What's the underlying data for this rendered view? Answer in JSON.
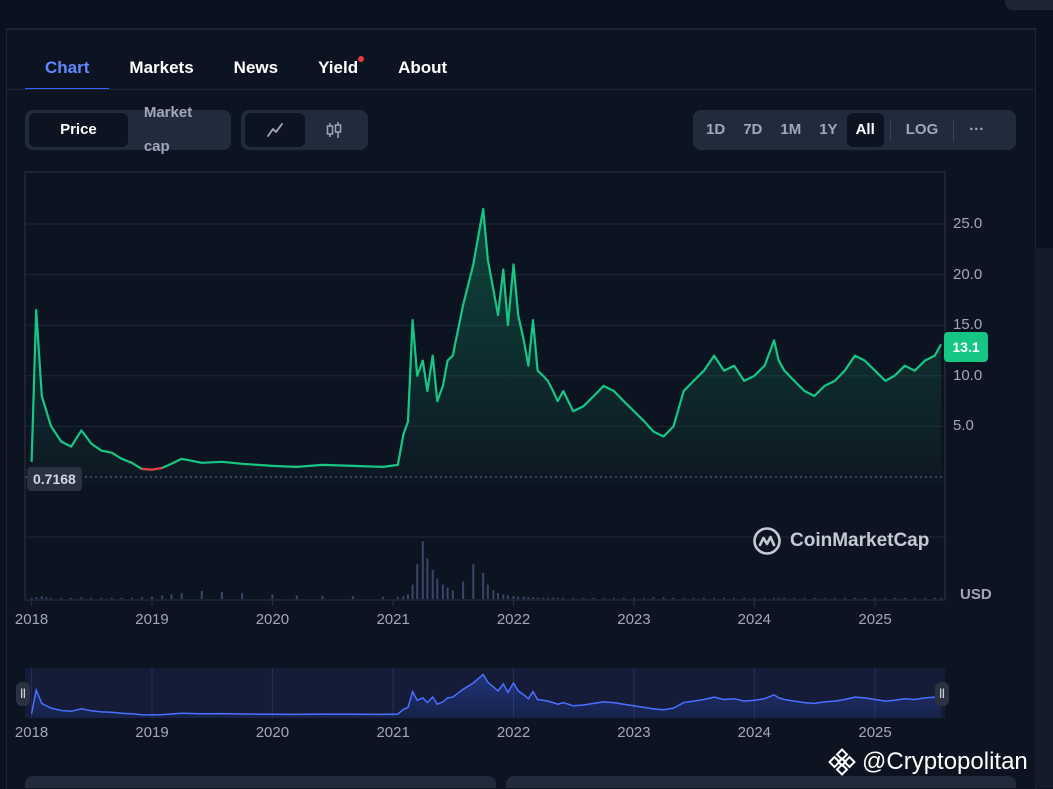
{
  "tabs": [
    {
      "label": "Chart",
      "active": true
    },
    {
      "label": "Markets",
      "active": false
    },
    {
      "label": "News",
      "active": false
    },
    {
      "label": "Yield",
      "active": false,
      "badge": true
    },
    {
      "label": "About",
      "active": false
    }
  ],
  "toolbar": {
    "price_label": "Price",
    "marketcap_label": "Market cap",
    "line_icon": "line-chart-icon",
    "candle_icon": "candlestick-icon",
    "ranges": [
      "1D",
      "7D",
      "1M",
      "1Y",
      "All"
    ],
    "selected_range": "All",
    "log_label": "LOG",
    "more_label": "···"
  },
  "chart_data": {
    "type": "area",
    "x": [
      "2018-01-01",
      "2018-01-15",
      "2018-02-01",
      "2018-02-15",
      "2018-03-01",
      "2018-04-01",
      "2018-05-01",
      "2018-06-01",
      "2018-07-01",
      "2018-08-01",
      "2018-09-01",
      "2018-10-01",
      "2018-11-01",
      "2018-12-01",
      "2019-01-01",
      "2019-02-01",
      "2019-03-01",
      "2019-04-01",
      "2019-06-01",
      "2019-08-01",
      "2019-10-01",
      "2020-01-01",
      "2020-03-15",
      "2020-06-01",
      "2020-09-01",
      "2020-12-01",
      "2021-01-15",
      "2021-02-01",
      "2021-02-15",
      "2021-03-01",
      "2021-03-15",
      "2021-04-01",
      "2021-04-15",
      "2021-05-01",
      "2021-05-15",
      "2021-06-01",
      "2021-06-15",
      "2021-07-01",
      "2021-08-01",
      "2021-09-01",
      "2021-10-01",
      "2021-10-15",
      "2021-11-01",
      "2021-11-15",
      "2021-12-01",
      "2021-12-15",
      "2022-01-01",
      "2022-01-15",
      "2022-02-01",
      "2022-02-15",
      "2022-03-01",
      "2022-03-15",
      "2022-04-01",
      "2022-04-15",
      "2022-05-01",
      "2022-05-15",
      "2022-06-01",
      "2022-07-01",
      "2022-08-01",
      "2022-09-01",
      "2022-10-01",
      "2022-11-01",
      "2022-12-01",
      "2023-01-01",
      "2023-02-01",
      "2023-03-01",
      "2023-04-01",
      "2023-05-01",
      "2023-06-01",
      "2023-07-01",
      "2023-08-01",
      "2023-09-01",
      "2023-10-01",
      "2023-11-01",
      "2023-12-01",
      "2024-01-01",
      "2024-02-01",
      "2024-03-01",
      "2024-03-15",
      "2024-04-01",
      "2024-05-01",
      "2024-06-01",
      "2024-07-01",
      "2024-08-01",
      "2024-09-01",
      "2024-10-01",
      "2024-11-01",
      "2024-12-01",
      "2025-01-01",
      "2025-02-01",
      "2025-03-01",
      "2025-04-01",
      "2025-05-01",
      "2025-06-01",
      "2025-07-01",
      "2025-07-20"
    ],
    "values": [
      1.5,
      16.5,
      8.0,
      6.5,
      5.0,
      3.5,
      3.0,
      4.6,
      3.3,
      2.6,
      2.4,
      1.8,
      1.4,
      0.8,
      0.72,
      0.9,
      1.3,
      1.8,
      1.4,
      1.5,
      1.3,
      1.1,
      1.0,
      1.2,
      1.1,
      1.0,
      1.2,
      4.2,
      5.5,
      15.5,
      10.0,
      11.5,
      8.5,
      12.0,
      7.5,
      9.0,
      11.5,
      12.0,
      17.0,
      21.0,
      26.5,
      21.5,
      18.5,
      16.0,
      20.5,
      15.0,
      21.0,
      16.0,
      13.5,
      11.0,
      15.5,
      10.5,
      10.0,
      9.5,
      8.5,
      7.5,
      8.5,
      6.5,
      7.0,
      8.0,
      9.0,
      8.5,
      7.5,
      6.5,
      5.5,
      4.5,
      4.0,
      5.0,
      8.5,
      9.5,
      10.5,
      12.0,
      10.5,
      11.0,
      9.5,
      10.0,
      11.0,
      13.5,
      11.5,
      10.5,
      9.5,
      8.5,
      8.0,
      9.0,
      9.5,
      10.5,
      12.0,
      11.5,
      10.5,
      9.5,
      10.0,
      11.0,
      10.5,
      11.5,
      12.0,
      13.1
    ],
    "y_ticks": [
      "25.0",
      "20.0",
      "15.0",
      "10.0",
      "5.0"
    ],
    "x_ticks": [
      "2018",
      "2019",
      "2020",
      "2021",
      "2022",
      "2023",
      "2024",
      "2025"
    ],
    "ylim": [
      0,
      28
    ],
    "current_price": "13.1",
    "low_marker": "0.7168",
    "currency": "USD",
    "line_color": "#16c784",
    "low_color": "#ea3943",
    "grid": true,
    "volume": [
      0.02,
      0.03,
      0.05,
      0.03,
      0.02,
      0.02,
      0.02,
      0.03,
      0.02,
      0.02,
      0.02,
      0.02,
      0.02,
      0.03,
      0.04,
      0.06,
      0.08,
      0.1,
      0.14,
      0.12,
      0.1,
      0.08,
      0.06,
      0.05,
      0.05,
      0.04,
      0.04,
      0.05,
      0.08,
      0.25,
      0.6,
      1.0,
      0.7,
      0.5,
      0.35,
      0.25,
      0.2,
      0.15,
      0.3,
      0.6,
      0.45,
      0.25,
      0.15,
      0.1,
      0.08,
      0.06,
      0.05,
      0.04,
      0.04,
      0.03,
      0.03,
      0.02,
      0.02,
      0.02,
      0.02,
      0.02,
      0.02,
      0.02,
      0.02,
      0.02,
      0.02,
      0.02,
      0.02,
      0.02,
      0.02,
      0.03,
      0.03,
      0.02,
      0.02,
      0.02,
      0.02,
      0.02,
      0.02,
      0.02,
      0.02,
      0.02,
      0.02,
      0.02,
      0.02,
      0.02,
      0.02,
      0.02,
      0.02,
      0.02,
      0.02,
      0.02,
      0.02,
      0.02,
      0.02,
      0.02,
      0.02,
      0.02,
      0.02,
      0.02,
      0.02,
      0.02
    ]
  },
  "watermark": "CoinMarketCap",
  "credit": "@Cryptopolitan"
}
